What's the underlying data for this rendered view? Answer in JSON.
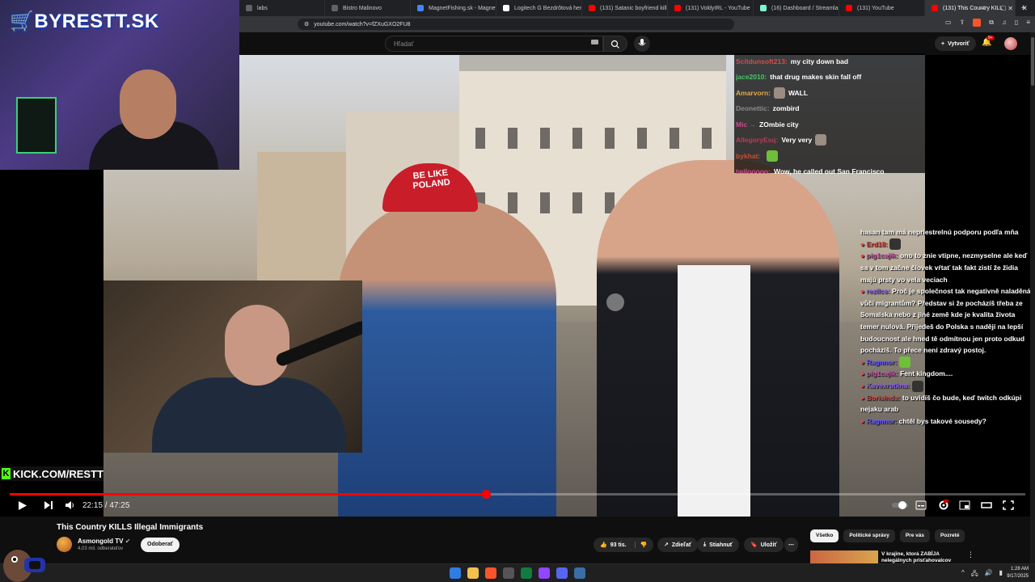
{
  "browser": {
    "tabs": [
      {
        "label": "labs",
        "color": "#5f6368",
        "active": false
      },
      {
        "label": "Bistro Malinovo",
        "color": "#5f6368",
        "active": false
      },
      {
        "label": "MagnetFishing.sk - Magnety",
        "color": "#4285f4",
        "active": false
      },
      {
        "label": "Logitech G Bezdrôtová herní",
        "color": "#ffffff",
        "active": false
      },
      {
        "label": "(131) Satanic boyfriend kills gi",
        "color": "#ff0000",
        "active": false
      },
      {
        "label": "(131) VoldyIRL - YouTube",
        "color": "#ff0000",
        "active": false
      },
      {
        "label": "(16) Dashboard / Streamlabs",
        "color": "#80f5d2",
        "active": false
      },
      {
        "label": "(131) YouTube",
        "color": "#ff0000",
        "active": false
      },
      {
        "label": "(131) This Country KILL",
        "color": "#ff0000",
        "active": true
      }
    ],
    "url": "youtube.com/watch?v=fZXuGXO2FU8"
  },
  "youtube": {
    "search_placeholder": "Hľadať",
    "create_label": "Vytvoriť",
    "notif_count": "9+"
  },
  "stream": {
    "logo_text": "BYRESTT.SK",
    "kick_text": "KICK.COM/RESTT",
    "cap_text": "BE LIKE POLAND"
  },
  "chat_top": [
    {
      "user": "Scitdunsoft213:",
      "color": "#d94b4b",
      "msg": "my city down bad"
    },
    {
      "user": "jace2010:",
      "color": "#49c46a",
      "msg": "that drug makes skin fall off"
    },
    {
      "user": "Amarvorn:",
      "color": "#e1a84a",
      "msg": "WALL"
    },
    {
      "user": "Deonettic:",
      "color": "#8a8a8a",
      "msg": "zombird"
    },
    {
      "user": "Mic →",
      "color": "#c94c8a",
      "msg": "ZOmbie city"
    },
    {
      "user": "AllegoryEsq:",
      "color": "#cc3355",
      "msg": "Very very"
    },
    {
      "user": "bykhat:",
      "color": "#d14b2c",
      "msg": ""
    },
    {
      "user": "twilooooo:",
      "color": "#d14b8a",
      "msg": "Wow, he called out San Francisco"
    }
  ],
  "chat_bottom": [
    {
      "user": "",
      "color": "#ffffff",
      "msg": "hasan tam má nepriestrelnú podporu podľa mňa"
    },
    {
      "user": "Erd18:",
      "color": "#d94b4b",
      "msg": ""
    },
    {
      "user": "pig1cajik:",
      "color": "#d946b8",
      "msg": "ono to znie vtipne, nezmyselne ale keď sa v tom začne človek vŕtať tak fakt zistí že židia majú prsty vo vela veciach"
    },
    {
      "user": "rezilcs:",
      "color": "#8a5cff",
      "msg": "Proč je společnost tak negativně naladěná vůči migrantům? Představ si že pocházíš třeba ze Somalska nebo z jiné země kde je kvalita života temer nulová. Přijedeš do Polska s nadějí na lepší budoucnost ale hned tě odmítnou jen proto odkud pocházíš. To přece není zdravý postoj."
    },
    {
      "user": "Ragnnor:",
      "color": "#6b5cff",
      "msg": ""
    },
    {
      "user": "pig1cajik:",
      "color": "#d946b8",
      "msg": "Fent kingdom...."
    },
    {
      "user": "Kavexrutkna:",
      "color": "#8a5cff",
      "msg": ""
    },
    {
      "user": "Borisinda:",
      "color": "#d94b4b",
      "msg": "to uvidíš čo bude, keď twitch odkúpi nejaku arab"
    },
    {
      "user": "Ragnnor:",
      "color": "#6b5cff",
      "msg": "chtěl bys takové sousedy?"
    }
  ],
  "player": {
    "current_time": "22:15",
    "duration": "47:25",
    "progress_fraction": 0.469
  },
  "video_info": {
    "title": "This Country KILLS Illegal Immigrants",
    "channel": "Asmongold TV",
    "subs": "4,03 mil. odberateľov",
    "subscribe_label": "Odoberať",
    "likes": "93 tis.",
    "share_label": "Zdieľať",
    "download_label": "Stiahnuť",
    "save_label": "Uložiť"
  },
  "chips": [
    "Všetko",
    "Politické správy",
    "Pre vás",
    "Pozreté"
  ],
  "recommendation": {
    "title": "V krajine, ktorá ZABÍJA nelegálnych prisťahovalcov"
  },
  "taskbar": {
    "time": "1:28 AM",
    "date": "9/17/2025",
    "apps": [
      "#2f7de1",
      "#f2c14e",
      "#fb542b",
      "#555555",
      "#107c41",
      "#9146ff",
      "#5865f2",
      "#3a6ea5"
    ]
  }
}
